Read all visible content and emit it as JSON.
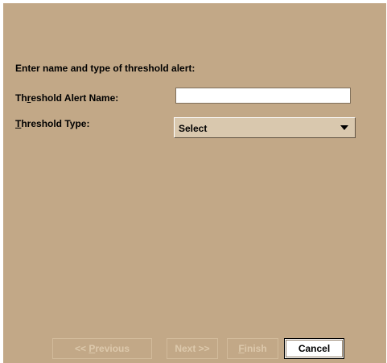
{
  "form": {
    "heading": "Enter name and type of threshold alert:",
    "name_label_pre": "Th",
    "name_label_mn": "r",
    "name_label_post": "eshold Alert Name:",
    "name_value": "",
    "type_label_mn": "T",
    "type_label_post": "hreshold Type:",
    "type_selected": "Select"
  },
  "buttons": {
    "previous_pre": "<< ",
    "previous_mn": "P",
    "previous_post": "revious",
    "next": "Next >>",
    "finish_mn": "F",
    "finish_post": "inish",
    "cancel": "Cancel"
  },
  "colors": {
    "dialog_background": "#c2a887",
    "disabled_text": "#ddc9ac"
  }
}
